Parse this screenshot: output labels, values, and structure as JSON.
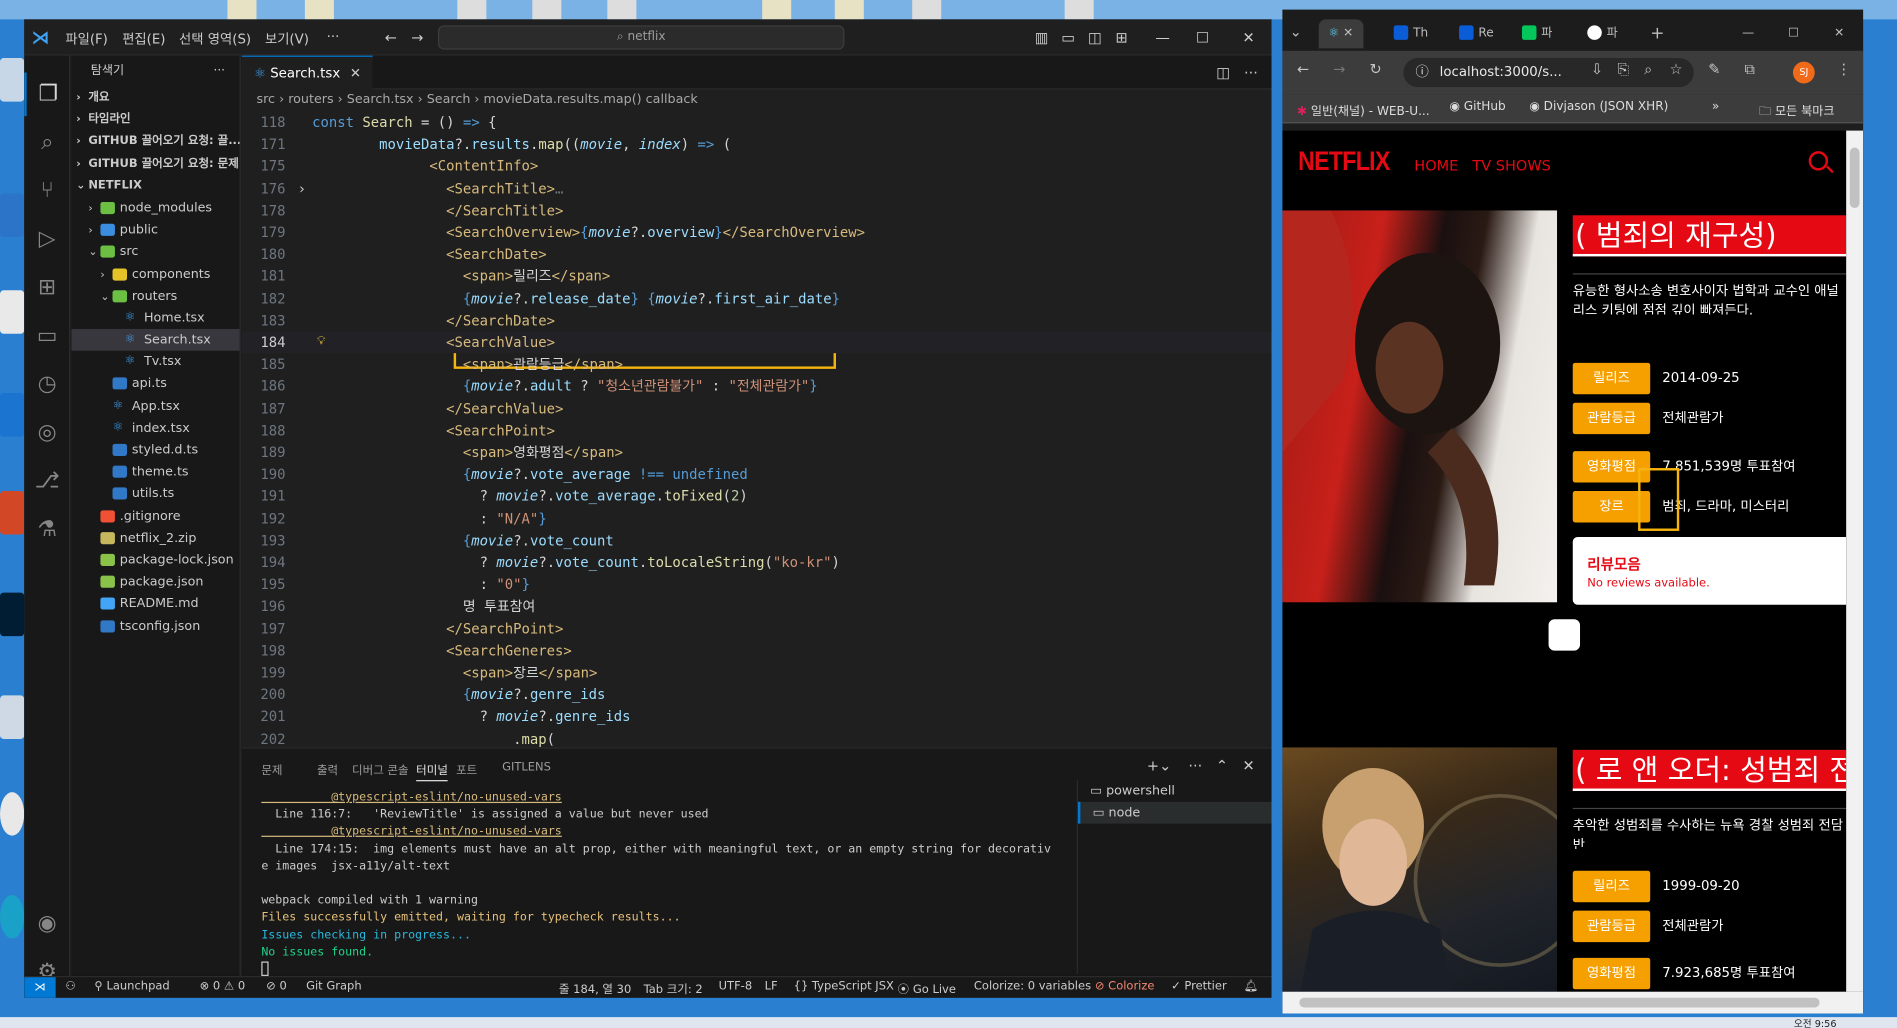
{
  "vscode": {
    "menu": [
      "파일(F)",
      "편집(E)",
      "선택 영역(S)",
      "보기(V)",
      "···"
    ],
    "search_placeholder": "netflix",
    "explorer": {
      "title": "탐색기",
      "sections": [
        "개요",
        "타임라인",
        "GITHUB 끌어오기 요청: 끌...",
        "GITHUB 끌어오기 요청: 문제"
      ],
      "root": "NETFLIX",
      "tree": [
        {
          "label": "node_modules",
          "indent": 1,
          "chev": "›",
          "icon": "folder-green"
        },
        {
          "label": "public",
          "indent": 1,
          "chev": "›",
          "icon": "folder-blue"
        },
        {
          "label": "src",
          "indent": 1,
          "chev": "⌄",
          "icon": "folder"
        },
        {
          "label": "components",
          "indent": 2,
          "chev": "›",
          "icon": "folder-yellow"
        },
        {
          "label": "routers",
          "indent": 2,
          "chev": "⌄",
          "icon": "folder-green"
        },
        {
          "label": "Home.tsx",
          "indent": 3,
          "chev": "",
          "icon": "react"
        },
        {
          "label": "Search.tsx",
          "indent": 3,
          "chev": "",
          "icon": "react",
          "selected": true
        },
        {
          "label": "Tv.tsx",
          "indent": 3,
          "chev": "",
          "icon": "react"
        },
        {
          "label": "api.ts",
          "indent": 2,
          "chev": "",
          "icon": "ts"
        },
        {
          "label": "App.tsx",
          "indent": 2,
          "chev": "",
          "icon": "react"
        },
        {
          "label": "index.tsx",
          "indent": 2,
          "chev": "",
          "icon": "react"
        },
        {
          "label": "styled.d.ts",
          "indent": 2,
          "chev": "",
          "icon": "ts"
        },
        {
          "label": "theme.ts",
          "indent": 2,
          "chev": "",
          "icon": "ts"
        },
        {
          "label": "utils.ts",
          "indent": 2,
          "chev": "",
          "icon": "ts"
        },
        {
          "label": ".gitignore",
          "indent": 1,
          "chev": "",
          "icon": "git"
        },
        {
          "label": "netflix_2.zip",
          "indent": 1,
          "chev": "",
          "icon": "zip"
        },
        {
          "label": "package-lock.json",
          "indent": 1,
          "chev": "",
          "icon": "npm"
        },
        {
          "label": "package.json",
          "indent": 1,
          "chev": "",
          "icon": "npm"
        },
        {
          "label": "README.md",
          "indent": 1,
          "chev": "",
          "icon": "info"
        },
        {
          "label": "tsconfig.json",
          "indent": 1,
          "chev": "",
          "icon": "ts"
        }
      ]
    },
    "tab": {
      "label": "Search.tsx"
    },
    "breadcrumb": [
      "src",
      "routers",
      "Search.tsx",
      "Search",
      "movieData.results.map() callback"
    ],
    "current_line": 184,
    "code_lines": [
      {
        "n": 118,
        "html": "<span class='kw'>const</span> <span class='fn'>Search</span> = () <span class='kw'>=&gt;</span> {"
      },
      {
        "n": 171,
        "html": "        <span class='pm' style='font-style:normal'>movieData</span>?.<span class='pm' style='font-style:normal'>results</span>.<span class='fn'>map</span>((<span class='pm'>movie</span>, <span class='pm'>index</span>) <span class='kw'>=&gt;</span> ("
      },
      {
        "n": 175,
        "html": "              <span class='tag'>&lt;ContentInfo&gt;</span>"
      },
      {
        "n": 176,
        "html": "                <span class='tag'>&lt;SearchTitle&gt;</span><span style='color:#6e7681'>…</span>"
      },
      {
        "n": 178,
        "html": "                <span class='tag'>&lt;/SearchTitle&gt;</span>"
      },
      {
        "n": 179,
        "html": "                <span class='tag'>&lt;SearchOverview&gt;</span><span class='kw'>{</span><span class='pm'>movie</span>?.<span class='pm' style='font-style:normal'>overview</span><span class='kw'>}</span><span class='tag'>&lt;/SearchOverview&gt;</span>"
      },
      {
        "n": 180,
        "html": "                <span class='tag'>&lt;SearchDate&gt;</span>"
      },
      {
        "n": 181,
        "html": "                  <span class='tag'>&lt;span&gt;</span>릴리즈<span class='tag'>&lt;/span&gt;</span>"
      },
      {
        "n": 182,
        "html": "                  <span class='kw'>{</span><span class='pm'>movie</span>?.<span class='pm' style='font-style:normal'>release_date</span><span class='kw'>}</span> <span class='kw'>{</span><span class='pm'>movie</span>?.<span class='pm' style='font-style:normal'>first_air_date</span><span class='kw'>}</span>"
      },
      {
        "n": 183,
        "html": "                <span class='tag'>&lt;/SearchDate&gt;</span>"
      },
      {
        "n": 184,
        "html": "                <span class='tag'>&lt;SearchValue&gt;</span>"
      },
      {
        "n": 185,
        "html": "                  <span class='tag'>&lt;span&gt;</span>관람등급<span class='tag'>&lt;/span&gt;</span>"
      },
      {
        "n": 186,
        "html": "                  <span class='kw'>{</span><span class='pm'>movie</span>?.<span class='pm' style='font-style:normal'>adult</span> ? <span class='str'>\"청소년관람불가\"</span> : <span class='str'>\"전체관람가\"</span><span class='kw'>}</span>"
      },
      {
        "n": 187,
        "html": "                <span class='tag'>&lt;/SearchValue&gt;</span>"
      },
      {
        "n": 188,
        "html": "                <span class='tag'>&lt;SearchPoint&gt;</span>"
      },
      {
        "n": 189,
        "html": "                  <span class='tag'>&lt;span&gt;</span>영화평점<span class='tag'>&lt;/span&gt;</span>"
      },
      {
        "n": 190,
        "html": "                  <span class='kw'>{</span><span class='pm'>movie</span>?.<span class='pm' style='font-style:normal'>vote_average</span> <span class='kw'>!==</span> <span class='kw'>undefined</span>"
      },
      {
        "n": 191,
        "html": "                    ? <span class='pm'>movie</span>?.<span class='pm' style='font-style:normal'>vote_average</span>.<span class='fn'>toFixed</span>(<span class='str' style='color:#b5cea8'>2</span>)"
      },
      {
        "n": 192,
        "html": "                    : <span class='str'>\"N/A\"</span><span class='kw'>}</span>"
      },
      {
        "n": 193,
        "html": "                  <span class='kw'>{</span><span class='pm'>movie</span>?.<span class='pm' style='font-style:normal'>vote_count</span>"
      },
      {
        "n": 194,
        "html": "                    ? <span class='pm'>movie</span>?.<span class='pm' style='font-style:normal'>vote_count</span>.<span class='fn'>toLocaleString</span>(<span class='str'>\"ko-kr\"</span>)"
      },
      {
        "n": 195,
        "html": "                    : <span class='str'>\"0\"</span><span class='kw'>}</span>"
      },
      {
        "n": 196,
        "html": "                  명 투표참여"
      },
      {
        "n": 197,
        "html": "                <span class='tag'>&lt;/SearchPoint&gt;</span>"
      },
      {
        "n": 198,
        "html": "                <span class='tag'>&lt;SearchGeneres&gt;</span>"
      },
      {
        "n": 199,
        "html": "                  <span class='tag'>&lt;span&gt;</span>장르<span class='tag'>&lt;/span&gt;</span>"
      },
      {
        "n": 200,
        "html": "                  <span class='kw'>{</span><span class='pm'>movie</span>?.<span class='pm' style='font-style:normal'>genre_ids</span>"
      },
      {
        "n": 201,
        "html": "                    ? <span class='pm'>movie</span>?.<span class='pm' style='font-style:normal'>genre_ids</span>"
      },
      {
        "n": 202,
        "html": "                        .<span class='fn'>map</span>("
      }
    ],
    "panel": {
      "tabs": [
        "문제",
        "출력",
        "디버그 콘솔",
        "터미널",
        "포트",
        "GITLENS"
      ],
      "active_tab": "터미널",
      "terminal_lines": [
        {
          "text": "          @typescript-eslint/no-unused-vars",
          "color": "#d7ba7d",
          "u": true
        },
        {
          "text": "  Line 116:7:   'ReviewTitle' is assigned a value but never used",
          "color": "#cccccc"
        },
        {
          "text": "          @typescript-eslint/no-unused-vars",
          "color": "#d7ba7d",
          "u": true
        },
        {
          "text": "  Line 174:15:  img elements must have an alt prop, either with meaningful text, or an empty string for decorativ",
          "color": "#cccccc"
        },
        {
          "text": "e images  jsx-a11y/alt-text",
          "color": "#cccccc"
        },
        {
          "text": "",
          "color": "#cccccc"
        },
        {
          "text": "webpack compiled with 1 warning",
          "color": "#cccccc"
        },
        {
          "text": "Files successfully emitted, waiting for typecheck results...",
          "color": "#e5c07b"
        },
        {
          "text": "Issues checking in progress...",
          "color": "#29b8db"
        },
        {
          "text": "No issues found.",
          "color": "#23d18b"
        }
      ],
      "terminals": [
        "powershell",
        "node"
      ]
    },
    "statusbar": {
      "launchpad": "Launchpad",
      "errors": "⊗ 0 ⚠ 0",
      "ports": "⊘ 0",
      "gitgraph": "Git Graph",
      "position": "줄 184, 열 30",
      "tabsize": "Tab 크기: 2",
      "encoding": "UTF-8",
      "eol": "LF",
      "language": "TypeScript JSX",
      "golive": "Go Live",
      "colorize_vars": "Colorize: 0 variables",
      "colorize": "Colorize",
      "prettier": "Prettier"
    }
  },
  "chrome": {
    "tabs": [
      "Th",
      "Re",
      "파",
      "파"
    ],
    "url": "localhost:3000/s...",
    "bookmarks": [
      "일반(채널) - WEB-U...",
      "GitHub",
      "Divjason (JSON XHR)",
      "모든 북마크"
    ],
    "netflix": {
      "logo": "NETFLIX",
      "nav": [
        "HOME",
        "TV SHOWS"
      ],
      "items": [
        {
          "title": "( 범죄의 재구성)",
          "overview": "유능한 형사소송 변호사이자 법학과 교수인 애널리스 키팅에 점점 깊이 빠져든다.",
          "rows": [
            {
              "label": "릴리즈",
              "value": "2014-09-25"
            },
            {
              "label": "관람등급",
              "value": "전체관람가"
            },
            {
              "label": "영화평점",
              "value": "7.851,539명 투표참여"
            },
            {
              "label": "장르",
              "value": "범죄, 드라마, 미스터리"
            }
          ],
          "reviews_title": "리뷰모음",
          "reviews_empty": "No reviews available."
        },
        {
          "title": "( 로 앤 오더: 성범죄 전담반)",
          "overview": "추악한 성범죄를 수사하는 뉴욕 경찰 성범죄 전담반",
          "rows": [
            {
              "label": "릴리즈",
              "value": "1999-09-20"
            },
            {
              "label": "관람등급",
              "value": "전체관람가"
            },
            {
              "label": "영화평점",
              "value": "7.923,685명 투표참여"
            }
          ]
        }
      ]
    }
  }
}
